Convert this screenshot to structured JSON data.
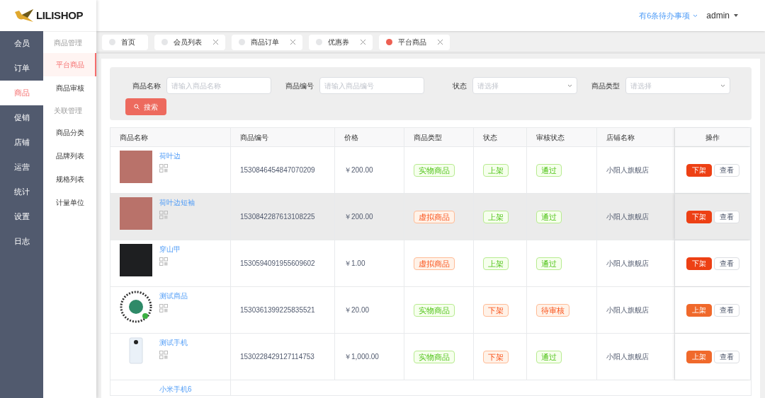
{
  "logo": {
    "text": "LILISHOP"
  },
  "header": {
    "todo": "有6条待办事项",
    "user": "admin"
  },
  "sidebar": {
    "items": [
      {
        "label": "会员",
        "selected": false
      },
      {
        "label": "订单",
        "selected": false
      },
      {
        "label": "商品",
        "selected": true
      },
      {
        "label": "促销",
        "selected": false
      },
      {
        "label": "店铺",
        "selected": false
      },
      {
        "label": "运营",
        "selected": false
      },
      {
        "label": "统计",
        "selected": false
      },
      {
        "label": "设置",
        "selected": false
      },
      {
        "label": "日志",
        "selected": false
      }
    ]
  },
  "submenu": {
    "groups": [
      {
        "title": "商品管理",
        "items": [
          {
            "label": "平台商品",
            "selected": true
          },
          {
            "label": "商品审核",
            "selected": false
          }
        ]
      },
      {
        "title": "关联管理",
        "items": [
          {
            "label": "商品分类",
            "selected": false
          },
          {
            "label": "品牌列表",
            "selected": false
          },
          {
            "label": "规格列表",
            "selected": false
          },
          {
            "label": "计量单位",
            "selected": false
          }
        ]
      }
    ]
  },
  "tabs": [
    {
      "label": "首页",
      "selected": false,
      "closable": false
    },
    {
      "label": "会员列表",
      "selected": false,
      "closable": true
    },
    {
      "label": "商品订单",
      "selected": false,
      "closable": true
    },
    {
      "label": "优惠券",
      "selected": false,
      "closable": true
    },
    {
      "label": "平台商品",
      "selected": true,
      "closable": true
    }
  ],
  "filters": [
    {
      "kind": "input",
      "label": "商品名称",
      "placeholder": "请输入商品名称"
    },
    {
      "kind": "input",
      "label": "商品编号",
      "placeholder": "请输入商品编号"
    },
    {
      "kind": "select",
      "label": "状态",
      "placeholder": "请选择"
    },
    {
      "kind": "select",
      "label": "商品类型",
      "placeholder": "请选择"
    }
  ],
  "search_button": "搜索",
  "table": {
    "columns": [
      "商品名称",
      "商品编号",
      "价格",
      "商品类型",
      "状态",
      "审核状态",
      "店铺名称",
      "操作"
    ],
    "rows": [
      {
        "name": "荷叶边",
        "code": "1530846454847070209",
        "price": "￥200.00",
        "type": {
          "label": "实物商品",
          "kind": "success"
        },
        "status": {
          "label": "上架",
          "kind": "success"
        },
        "audit": {
          "label": "通过",
          "kind": "success"
        },
        "shop": "小阳人旗舰店",
        "actions": [
          {
            "label": "下架",
            "kind": "danger"
          },
          {
            "label": "查看",
            "kind": "default"
          }
        ],
        "selected": false
      },
      {
        "name": "荷叶边短袖",
        "code": "1530842287613108225",
        "price": "￥200.00",
        "type": {
          "label": "虚拟商品",
          "kind": "warning"
        },
        "status": {
          "label": "上架",
          "kind": "success"
        },
        "audit": {
          "label": "通过",
          "kind": "success"
        },
        "shop": "小阳人旗舰店",
        "actions": [
          {
            "label": "下架",
            "kind": "danger"
          },
          {
            "label": "查看",
            "kind": "default"
          }
        ],
        "selected": true
      },
      {
        "name": "穿山甲",
        "code": "1530594091955609602",
        "price": "￥1.00",
        "type": {
          "label": "虚拟商品",
          "kind": "warning"
        },
        "status": {
          "label": "上架",
          "kind": "success"
        },
        "audit": {
          "label": "通过",
          "kind": "success"
        },
        "shop": "小阳人旗舰店",
        "actions": [
          {
            "label": "下架",
            "kind": "danger"
          },
          {
            "label": "查看",
            "kind": "default"
          }
        ],
        "selected": false
      },
      {
        "name": "测试商品",
        "code": "1530361399225835521",
        "price": "￥20.00",
        "type": {
          "label": "实物商品",
          "kind": "success"
        },
        "status": {
          "label": "下架",
          "kind": "warning"
        },
        "audit": {
          "label": "待审核",
          "kind": "warning"
        },
        "shop": "小阳人旗舰店",
        "actions": [
          {
            "label": "上架",
            "kind": "primary"
          },
          {
            "label": "查看",
            "kind": "default"
          }
        ],
        "selected": false
      },
      {
        "name": "测试手机",
        "code": "1530228429127114753",
        "price": "￥1,000.00",
        "type": {
          "label": "实物商品",
          "kind": "success"
        },
        "status": {
          "label": "下架",
          "kind": "warning"
        },
        "audit": {
          "label": "通过",
          "kind": "success"
        },
        "shop": "小阳人旗舰店",
        "actions": [
          {
            "label": "上架",
            "kind": "primary"
          },
          {
            "label": "查看",
            "kind": "default"
          }
        ],
        "selected": false
      },
      {
        "name": "小米手机6",
        "selected": false
      }
    ]
  }
}
